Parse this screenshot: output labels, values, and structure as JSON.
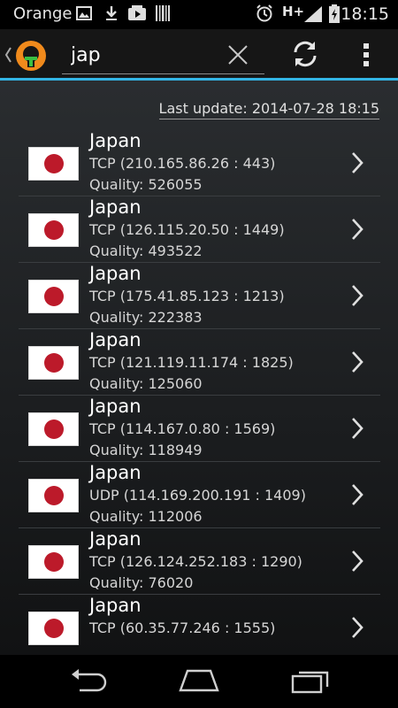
{
  "status_bar": {
    "carrier": "Orange",
    "network": "H+",
    "time": "18:15",
    "icons": [
      "image-icon",
      "download-icon",
      "youtube-icon",
      "barcode-icon",
      "alarm-icon",
      "signal-icon",
      "battery-icon"
    ]
  },
  "action_bar": {
    "search_value": "jap",
    "icons": [
      "back-chevron-icon",
      "openvpn-logo-icon",
      "close-icon",
      "refresh-icon",
      "overflow-menu-icon"
    ]
  },
  "content": {
    "last_update": "Last update: 2014-07-28 18:15",
    "servers": [
      {
        "country": "Japan",
        "protocol": "TCP (210.165.86.26 : 443)",
        "quality": "Quality: 526055"
      },
      {
        "country": "Japan",
        "protocol": "TCP (126.115.20.50 : 1449)",
        "quality": "Quality: 493522"
      },
      {
        "country": "Japan",
        "protocol": "TCP (175.41.85.123 : 1213)",
        "quality": "Quality: 222383"
      },
      {
        "country": "Japan",
        "protocol": "TCP (121.119.11.174 : 1825)",
        "quality": "Quality: 125060"
      },
      {
        "country": "Japan",
        "protocol": "TCP (114.167.0.80 : 1569)",
        "quality": "Quality: 118949"
      },
      {
        "country": "Japan",
        "protocol": "UDP (114.169.200.191 : 1409)",
        "quality": "Quality: 112006"
      },
      {
        "country": "Japan",
        "protocol": "TCP (126.124.252.183 : 1290)",
        "quality": "Quality: 76020"
      },
      {
        "country": "Japan",
        "protocol": "TCP (60.35.77.246 : 1555)",
        "quality": ""
      }
    ]
  },
  "nav_bar": {
    "icons": [
      "back-icon",
      "home-icon",
      "recent-apps-icon"
    ]
  },
  "colors": {
    "accent": "#33b5e5",
    "flag_red": "#bc1a2a",
    "logo_orange": "#f08a1c"
  }
}
